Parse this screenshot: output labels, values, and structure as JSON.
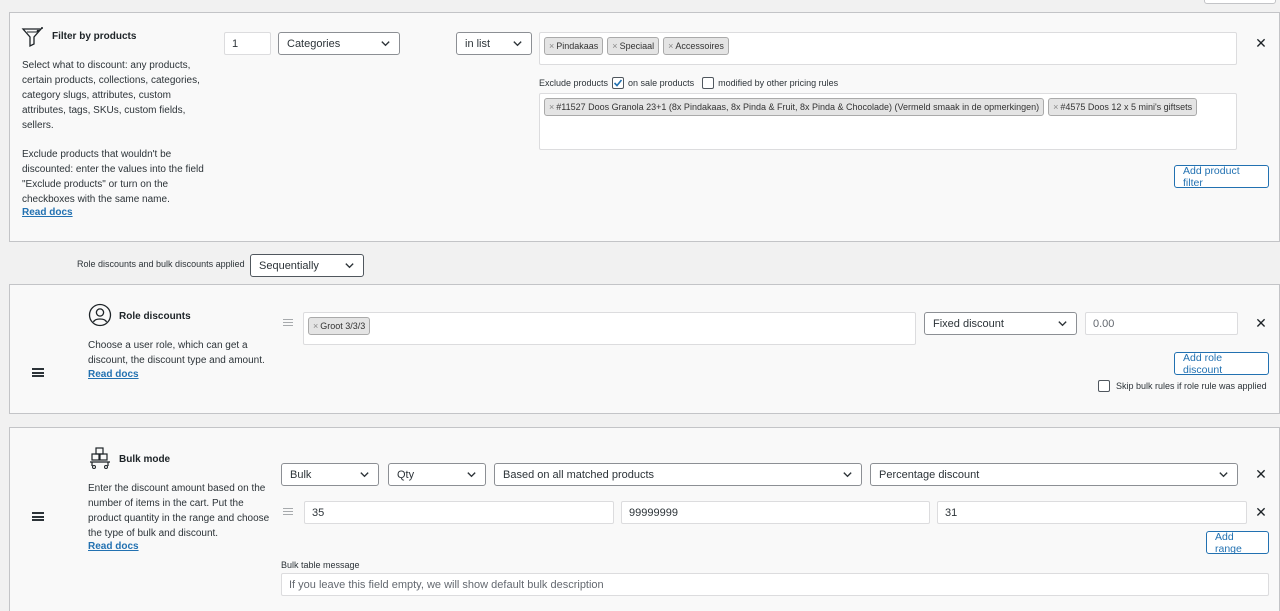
{
  "filter": {
    "title": "Filter by products",
    "desc_1": "Select what to discount: any products, certain products, collections, categories, category slugs, attributes, custom attributes, tags, SKUs, custom fields, sellers.",
    "desc_2": "Exclude products that wouldn't be discounted: enter the values into the field \"Exclude products\" or turn on the checkboxes with the same name.",
    "read_docs": "Read docs",
    "qty_value": "1",
    "type_select": "Categories",
    "method_select": "in list",
    "tags": [
      "Pindakaas",
      "Speciaal",
      "Accessoires"
    ],
    "exclude_label": "Exclude products",
    "on_sale_label": "on sale products",
    "on_sale_checked": true,
    "modified_label": "modified by other pricing rules",
    "modified_checked": false,
    "excluded_tags": [
      "#11527 Doos Granola 23+1 (8x Pindakaas, 8x Pinda & Fruit, 8x Pinda & Chocolade) (Vermeld smaak in de opmerkingen)",
      "#4575 Doos 12 x 5 mini's giftsets"
    ],
    "add_button": "Add product filter"
  },
  "applied": {
    "label": "Role discounts and bulk discounts applied",
    "select": "Sequentially"
  },
  "role": {
    "title": "Role discounts",
    "desc": "Choose a user role, which can get a discount, the discount type and amount.",
    "read_docs": "Read docs",
    "tags": [
      "Groot 3/3/3"
    ],
    "discount_type": "Fixed discount",
    "amount_placeholder": "0.00",
    "add_button": "Add role discount",
    "skip_label": "Skip bulk rules if role rule was applied",
    "skip_checked": false
  },
  "bulk": {
    "title": "Bulk mode",
    "desc": "Enter the discount amount based on the number of items in the cart. Put the product quantity in the range and choose the type of bulk and discount.",
    "read_docs": "Read docs",
    "mode_select": "Bulk",
    "measure_select": "Qty",
    "based_select": "Based on all matched products",
    "discount_select": "Percentage discount",
    "range_from": "35",
    "range_to": "99999999",
    "range_value": "31",
    "add_range": "Add range",
    "message_label": "Bulk table message",
    "message_placeholder": "If you leave this field empty, we will show default bulk description"
  },
  "icons": [
    "filter-icon",
    "user-circle-icon",
    "bulk-boxes-icon",
    "close-icon",
    "chevron-down-icon",
    "drag-handle-icon",
    "hamburger-icon",
    "checkmark-icon"
  ]
}
